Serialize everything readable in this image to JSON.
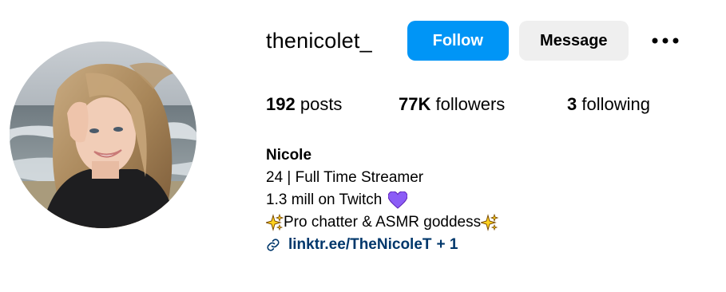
{
  "profile": {
    "username": "thenicolet_",
    "follow_label": "Follow",
    "message_label": "Message",
    "more_icon": "more-horizontal-icon"
  },
  "stats": {
    "posts_count": "192",
    "posts_label": "posts",
    "followers_count": "77K",
    "followers_label": "followers",
    "following_count": "3",
    "following_label": "following"
  },
  "bio": {
    "name": "Nicole",
    "line1": "24 | Full Time Streamer",
    "line2": "1.3 mill on Twitch",
    "line2_emoji": "purple-heart-icon",
    "line3": "Pro chatter & ASMR goddess",
    "line3_emoji": "sparkles-icon",
    "link_icon": "link-icon",
    "link_text": "linktr.ee/TheNicoleT",
    "link_extra": "+ 1"
  },
  "colors": {
    "follow_bg": "#0095f6",
    "message_bg": "#efefef",
    "link": "#00376b",
    "heart": "#8b5cf6"
  }
}
